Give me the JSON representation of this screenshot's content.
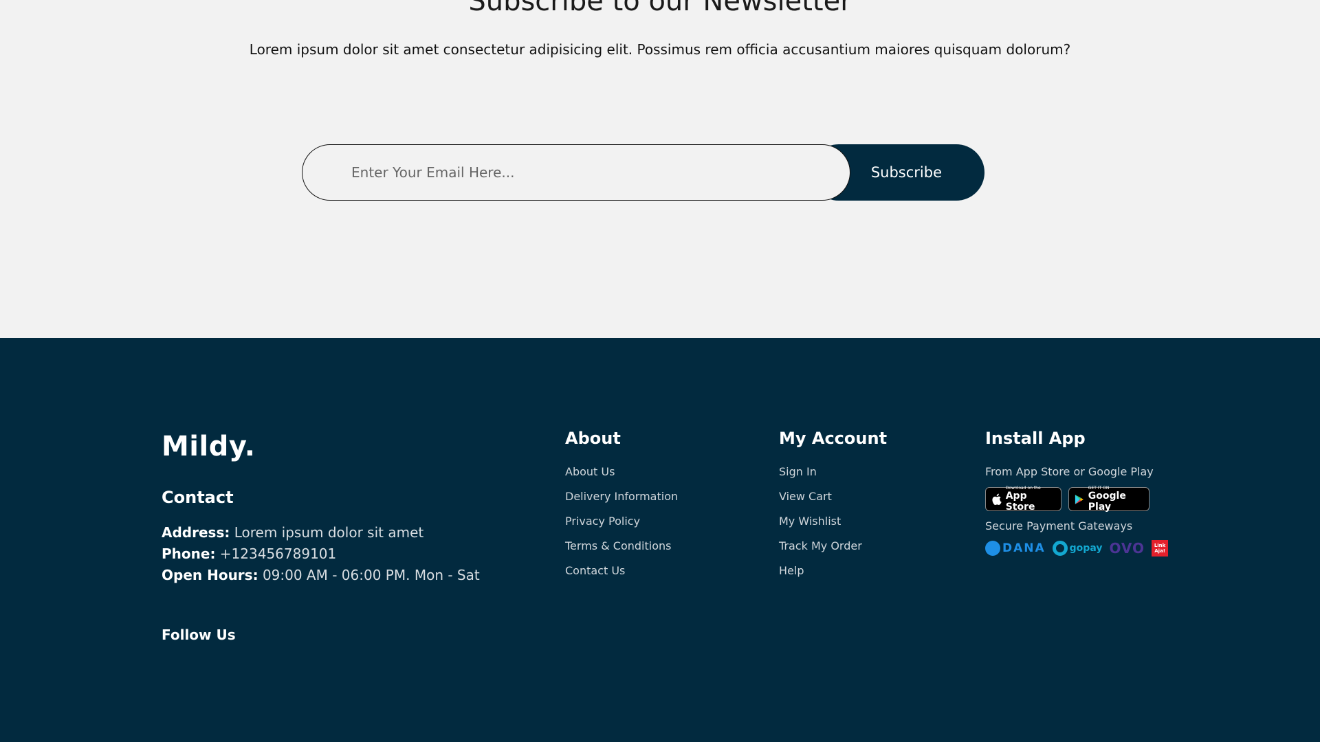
{
  "newsletter": {
    "title": "Subscribe to our Newsletter",
    "description": "Lorem ipsum dolor sit amet consectetur adipisicing elit. Possimus rem officia accusantium maiores quisquam dolorum?",
    "email_placeholder": "Enter Your Email Here...",
    "subscribe_label": "Subscribe"
  },
  "footer": {
    "brand": "Mildy.",
    "contact": {
      "heading": "Contact",
      "address_label": "Address:",
      "address_value": "Lorem ipsum dolor sit amet",
      "phone_label": "Phone:",
      "phone_value": "+123456789101",
      "hours_label": "Open Hours:",
      "hours_value": "09:00 AM - 06:00 PM. Mon - Sat"
    },
    "follow_heading": "Follow Us",
    "about": {
      "heading": "About",
      "links": [
        "About Us",
        "Delivery Information",
        "Privacy Policy",
        "Terms & Conditions",
        "Contact Us"
      ]
    },
    "account": {
      "heading": "My Account",
      "links": [
        "Sign In",
        "View Cart",
        "My Wishlist",
        "Track My Order",
        "Help"
      ]
    },
    "install": {
      "heading": "Install App",
      "subtitle": "From App Store or Google Play",
      "app_store_small": "Download on the",
      "app_store_big": "App Store",
      "google_play_small": "GET IT ON",
      "google_play_big": "Google Play",
      "payments_heading": "Secure Payment Gateways",
      "dana": "DANA",
      "gopay": "gopay",
      "ovo": "OVO",
      "linkaja": "Link Aja!"
    }
  },
  "colors": {
    "primary": "#022a3f",
    "background": "#f2f2f2"
  }
}
